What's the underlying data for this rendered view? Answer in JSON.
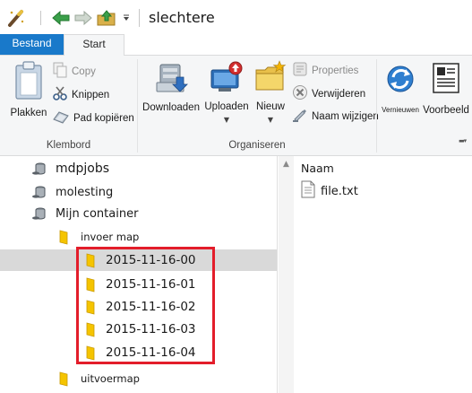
{
  "window": {
    "title": "slechtere"
  },
  "quick_access": [
    {
      "icon": "properties-wand-icon"
    },
    {
      "icon": "back-arrow-icon"
    },
    {
      "icon": "forward-arrow-icon"
    },
    {
      "icon": "up-folder-icon"
    },
    {
      "icon": "customize-dropdown-icon"
    }
  ],
  "tabs": {
    "file": "Bestand",
    "start": "Start"
  },
  "ribbon": {
    "clipboard": {
      "group_label": "Klembord",
      "paste": "Plakken",
      "copy": "Copy",
      "cut": "Knippen",
      "copy_path": "Pad kopiëren"
    },
    "organize": {
      "group_label": "Organiseren",
      "download": "Downloaden",
      "upload": "Uploaden",
      "new": "Nieuw",
      "properties": "Properties",
      "delete": "Verwijderen",
      "rename": "Naam wijzigen"
    },
    "view": {
      "refresh": "Vernieuwen",
      "preview": "Voorbeeld"
    }
  },
  "nav_tree": {
    "items": [
      {
        "label": "mdpjobs",
        "type": "storage"
      },
      {
        "label": "molesting",
        "type": "storage"
      },
      {
        "label": "Mijn container",
        "type": "storage"
      },
      {
        "label": "invoer map",
        "type": "folder"
      },
      {
        "label": "2015-11-16-00",
        "type": "folder",
        "selected": true
      },
      {
        "label": "2015-11-16-01",
        "type": "folder"
      },
      {
        "label": "2015-11-16-02",
        "type": "folder"
      },
      {
        "label": "2015-11-16-03",
        "type": "folder"
      },
      {
        "label": "2015-11-16-04",
        "type": "folder"
      },
      {
        "label": "uitvoermap",
        "type": "folder"
      }
    ]
  },
  "file_list": {
    "column_header": "Naam",
    "files": [
      {
        "name": "file.txt",
        "icon": "text-file-icon"
      }
    ]
  },
  "colors": {
    "accent": "#1979ca",
    "highlight_border": "#e31d2a",
    "selection": "#d9d9d9",
    "folder": "#f5c400"
  }
}
